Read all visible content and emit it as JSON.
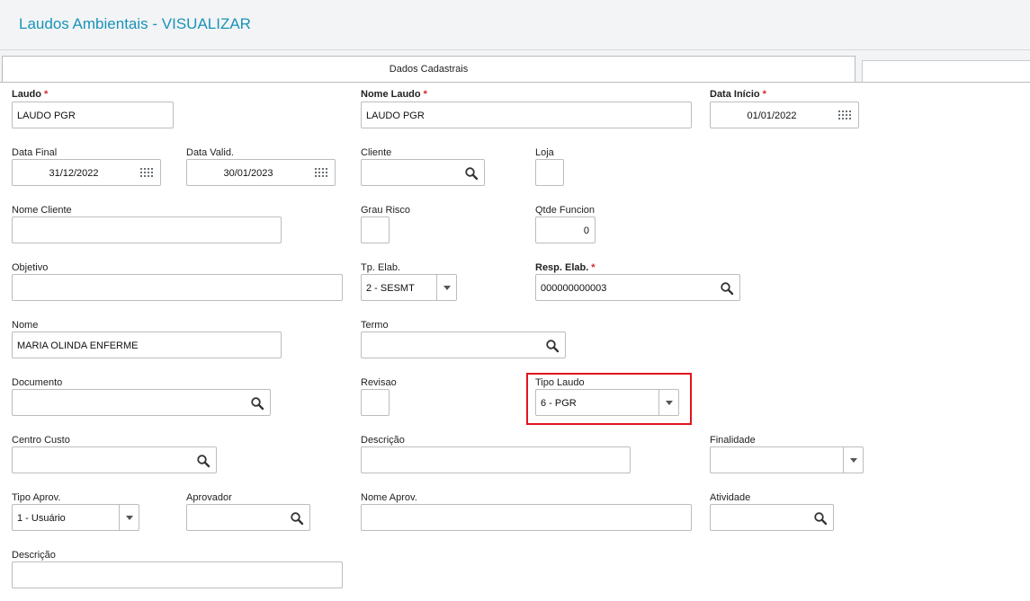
{
  "header": {
    "title": "Laudos Ambientais - VISUALIZAR"
  },
  "tabs": {
    "active_label": "Dados Cadastrais",
    "inactive_label": ""
  },
  "fields": {
    "laudo": {
      "label": "Laudo",
      "value": "LAUDO PGR"
    },
    "nome_laudo": {
      "label": "Nome Laudo",
      "value": "LAUDO PGR"
    },
    "data_inicio": {
      "label": "Data Início",
      "value": "01/01/2022"
    },
    "data_final": {
      "label": "Data Final",
      "value": "31/12/2022"
    },
    "data_valid": {
      "label": "Data Valid.",
      "value": "30/01/2023"
    },
    "cliente": {
      "label": "Cliente",
      "value": ""
    },
    "loja": {
      "label": "Loja",
      "value": ""
    },
    "nome_cliente": {
      "label": "Nome Cliente",
      "value": ""
    },
    "grau_risco": {
      "label": "Grau Risco",
      "value": ""
    },
    "qtde_funcion": {
      "label": "Qtde Funcion",
      "value": "0"
    },
    "objetivo": {
      "label": "Objetivo",
      "value": ""
    },
    "tp_elab": {
      "label": "Tp. Elab.",
      "value": "2 - SESMT"
    },
    "resp_elab": {
      "label": "Resp. Elab.",
      "value": "000000000003"
    },
    "nome": {
      "label": "Nome",
      "value": "MARIA OLINDA ENFERME"
    },
    "termo": {
      "label": "Termo",
      "value": ""
    },
    "documento": {
      "label": "Documento",
      "value": ""
    },
    "revisao": {
      "label": "Revisao",
      "value": ""
    },
    "tipo_laudo": {
      "label": "Tipo Laudo",
      "value": "6 - PGR"
    },
    "centro_custo": {
      "label": "Centro Custo",
      "value": ""
    },
    "descricao": {
      "label": "Descrição",
      "value": ""
    },
    "finalidade": {
      "label": "Finalidade",
      "value": ""
    },
    "tipo_aprov": {
      "label": "Tipo Aprov.",
      "value": "1 - Usuário"
    },
    "aprovador": {
      "label": "Aprovador",
      "value": ""
    },
    "nome_aprov": {
      "label": "Nome Aprov.",
      "value": ""
    },
    "atividade": {
      "label": "Atividade",
      "value": ""
    },
    "descricao2": {
      "label": "Descrição",
      "value": ""
    }
  },
  "required_marker": "*",
  "icons": {
    "lookup": "search-icon",
    "date": "calendar-icon",
    "select": "chevron-down-icon"
  },
  "colors": {
    "title": "#1a93b8",
    "required": "#d9262b",
    "highlight": "#e0141b"
  }
}
